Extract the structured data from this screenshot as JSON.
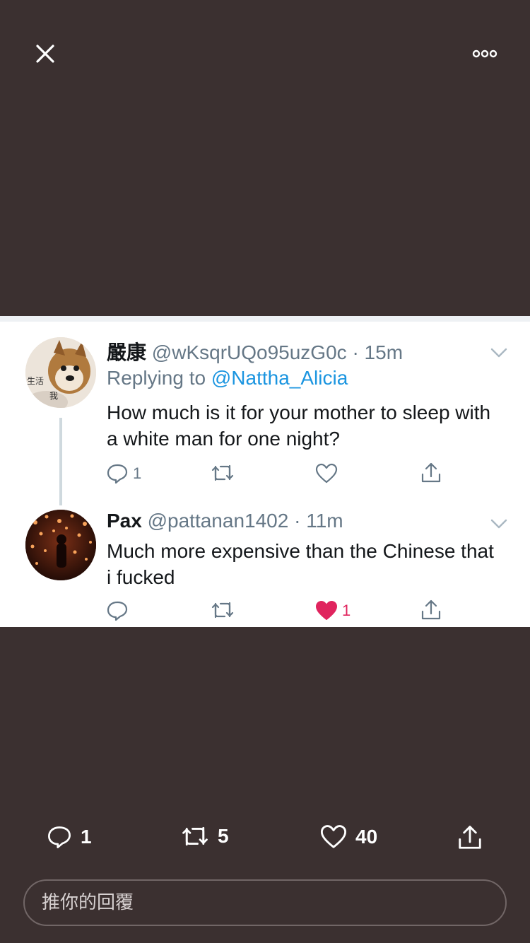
{
  "topbar": {
    "close_icon": "close-icon",
    "more_icon": "more-dots-icon"
  },
  "thread": {
    "tweets": [
      {
        "display_name": "嚴康",
        "handle": "@wKsqrUQo95uzG0c",
        "separator": "·",
        "time": "15m",
        "replying_prefix": "Replying to",
        "replying_mention": "@Nattha_Alicia",
        "text": "How much is it for your mother to sleep with a white man for one night?",
        "avatar_text_1": "生活",
        "avatar_text_2": "我",
        "reply_count": "1",
        "retweet_count": "",
        "like_count": "",
        "liked": false
      },
      {
        "display_name": "Pax",
        "handle": "@pattanan1402",
        "separator": "·",
        "time": "11m",
        "text": "Much more expensive than the Chinese that i fucked",
        "reply_count": "",
        "retweet_count": "",
        "like_count": "1",
        "liked": true
      }
    ]
  },
  "footer": {
    "reply_count": "1",
    "retweet_count": "5",
    "like_count": "40",
    "reply_placeholder": "推你的回覆"
  },
  "colors": {
    "background": "#3b3030",
    "like_red": "#e0245e",
    "link_blue": "#1b95e0",
    "muted": "#657786"
  }
}
